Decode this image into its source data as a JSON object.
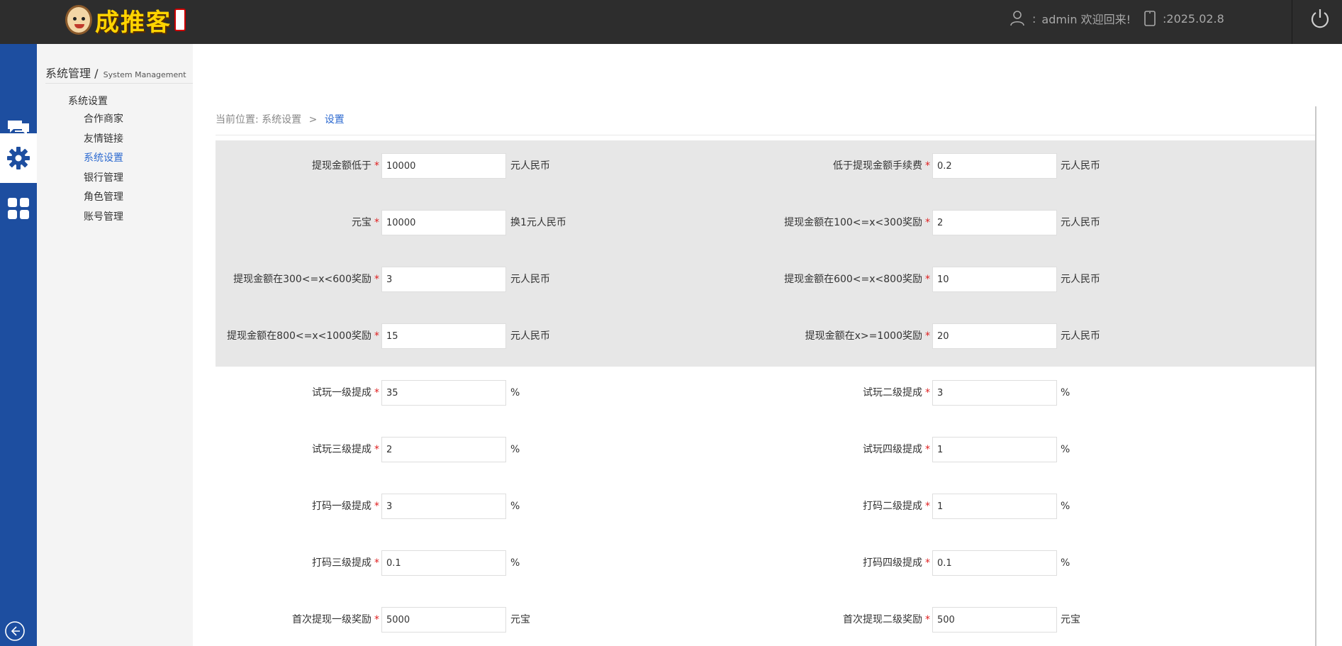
{
  "header": {
    "logo_text": "成推客",
    "user_text": "admin 欢迎回来!",
    "colon": ":",
    "date": "2025.02.8"
  },
  "icons": [
    "chat-icon",
    "gear-icon",
    "grid-icon",
    "back-icon",
    "power-icon",
    "user-icon",
    "phone-icon"
  ],
  "sidebar": {
    "title": "系统管理",
    "title_sep": "/",
    "title_en": "System Management",
    "group": "系统设置",
    "items": [
      "合作商家",
      "友情链接",
      "系统设置",
      "银行管理",
      "角色管理",
      "账号管理"
    ],
    "active_index": 2
  },
  "breadcrumb": {
    "prefix": "当前位置:",
    "parent": "系统设置",
    "sep": ">",
    "current": "设置"
  },
  "form": {
    "rows": [
      [
        {
          "label": "提现金额低于",
          "value": "10000",
          "unit": "元人民币"
        },
        {
          "label": "低于提现金额手续费",
          "value": "0.2",
          "unit": "元人民币"
        }
      ],
      [
        {
          "label": "元宝",
          "value": "10000",
          "unit": "换1元人民币"
        },
        {
          "label": "提现金额在100<=x<300奖励",
          "value": "2",
          "unit": "元人民币"
        }
      ],
      [
        {
          "label": "提现金额在300<=x<600奖励",
          "value": "3",
          "unit": "元人民币"
        },
        {
          "label": "提现金额在600<=x<800奖励",
          "value": "10",
          "unit": "元人民币"
        }
      ],
      [
        {
          "label": "提现金额在800<=x<1000奖励",
          "value": "15",
          "unit": "元人民币"
        },
        {
          "label": "提现金额在x>=1000奖励",
          "value": "20",
          "unit": "元人民币"
        }
      ],
      [
        {
          "label": "试玩一级提成",
          "value": "35",
          "unit": "%"
        },
        {
          "label": "试玩二级提成",
          "value": "3",
          "unit": "%"
        }
      ],
      [
        {
          "label": "试玩三级提成",
          "value": "2",
          "unit": "%"
        },
        {
          "label": "试玩四级提成",
          "value": "1",
          "unit": "%"
        }
      ],
      [
        {
          "label": "打码一级提成",
          "value": "3",
          "unit": "%"
        },
        {
          "label": "打码二级提成",
          "value": "1",
          "unit": "%"
        }
      ],
      [
        {
          "label": "打码三级提成",
          "value": "0.1",
          "unit": "%"
        },
        {
          "label": "打码四级提成",
          "value": "0.1",
          "unit": "%"
        }
      ],
      [
        {
          "label": "首次提现一级奖励",
          "value": "5000",
          "unit": "元宝"
        },
        {
          "label": "首次提现二级奖励",
          "value": "500",
          "unit": "元宝"
        }
      ]
    ],
    "required_mark": "*"
  },
  "colors": {
    "topbar": "#2d2d2d",
    "iconbar": "#1d4ea0",
    "accent": "#2d6ad0",
    "required": "#e02020",
    "panel": "#e7e7e7"
  }
}
